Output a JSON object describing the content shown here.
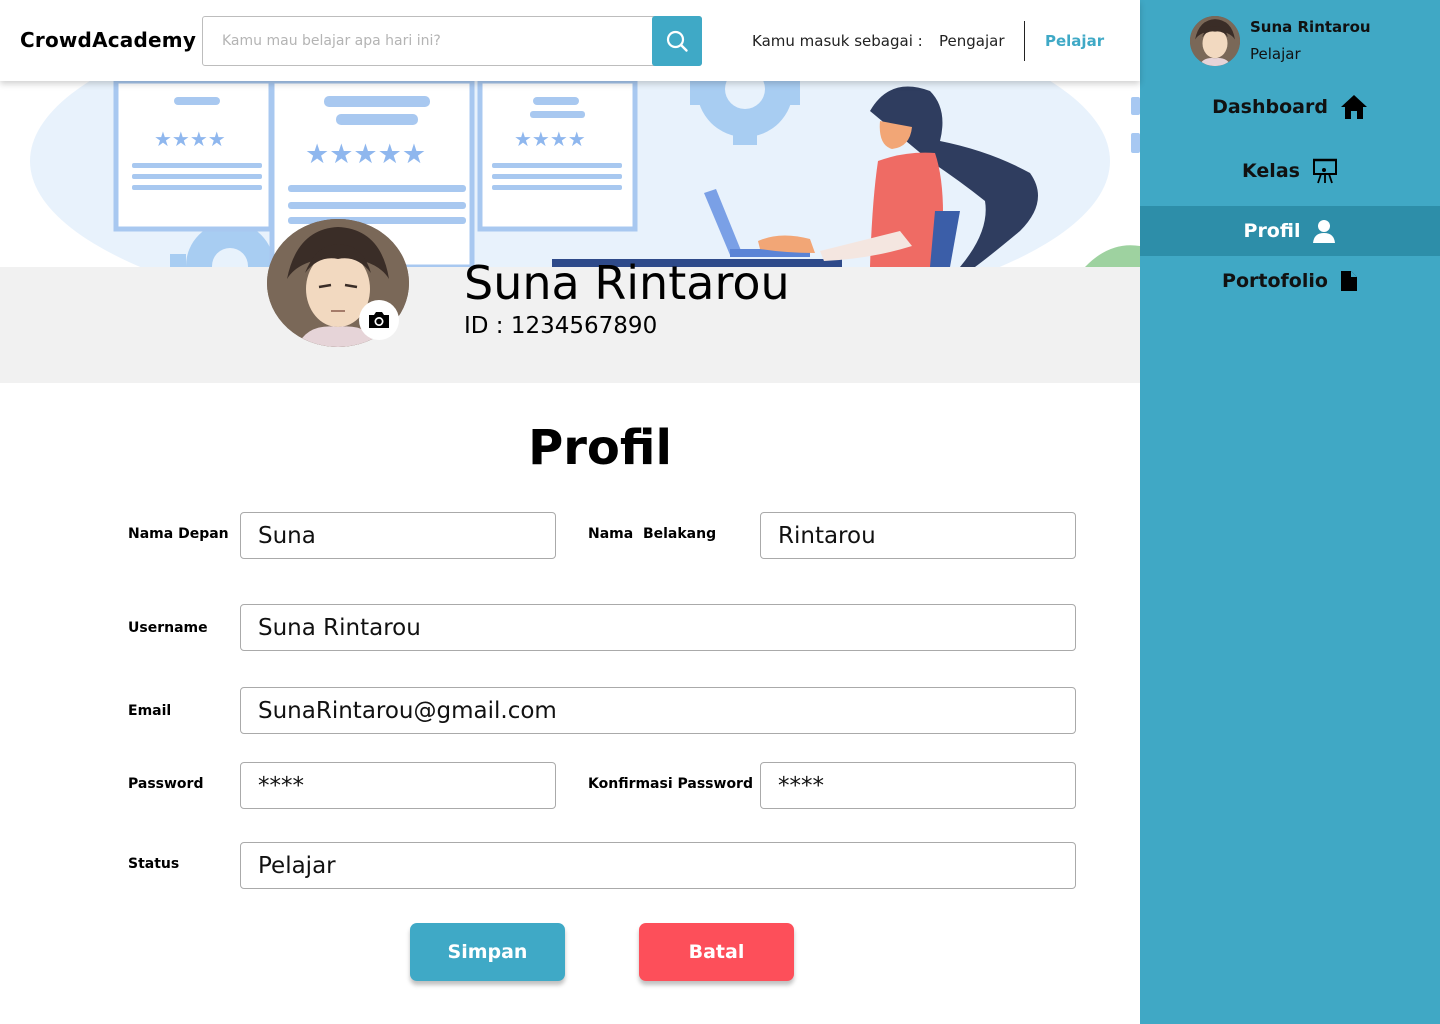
{
  "header": {
    "brand": "CrowdAcademy",
    "search_placeholder": "Kamu mau belajar apa hari ini?",
    "search_icon": "search-icon",
    "role_label": "Kamu masuk sebagai :",
    "role_teacher": "Pengajar",
    "role_student": "Pelajar",
    "accent_color": "#3fa9c6"
  },
  "profile": {
    "name": "Suna Rintarou",
    "id_text": "ID : 1234567890",
    "camera_icon": "camera-icon"
  },
  "form": {
    "title": "Profil",
    "first_name_label": "Nama Depan",
    "first_name_value": "Suna",
    "last_name_label": "Nama  Belakang",
    "last_name_value": "Rintarou",
    "username_label": "Username",
    "username_value": "Suna Rintarou",
    "email_label": "Email",
    "email_value": "SunaRintarou@gmail.com",
    "password_label": "Password",
    "password_value": "****",
    "confirm_password_label": "Konfirmasi Password",
    "confirm_password_value": "****",
    "status_label": "Status",
    "status_value": "Pelajar",
    "save_label": "Simpan",
    "cancel_label": "Batal",
    "save_color": "#3fa9c6",
    "cancel_color": "#fd4f5a"
  },
  "sidebar": {
    "user_name": "Suna Rintarou",
    "user_role": "Pelajar",
    "background_color": "#40a8c5",
    "items": [
      {
        "label": "Dashboard",
        "icon": "home-icon",
        "active": false
      },
      {
        "label": "Kelas",
        "icon": "presentation-icon",
        "active": false
      },
      {
        "label": "Profil",
        "icon": "user-icon",
        "active": true
      },
      {
        "label": "Portofolio",
        "icon": "document-icon",
        "active": false
      }
    ]
  }
}
